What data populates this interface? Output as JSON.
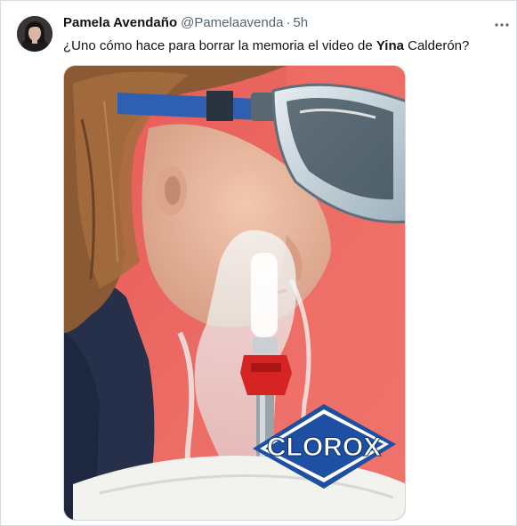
{
  "tweet": {
    "author_name": "Pamela Avendaño",
    "handle": "@Pamelaavenda",
    "separator": "·",
    "timestamp": "5h",
    "text_before": "¿Uno cómo hace para borrar la memoria el video de ",
    "text_bold": "Yina",
    "text_after": " Calderón?"
  },
  "media": {
    "logo_text": "CLOROX"
  },
  "icons": {
    "more": "more-options-icon",
    "avatar": "avatar"
  }
}
